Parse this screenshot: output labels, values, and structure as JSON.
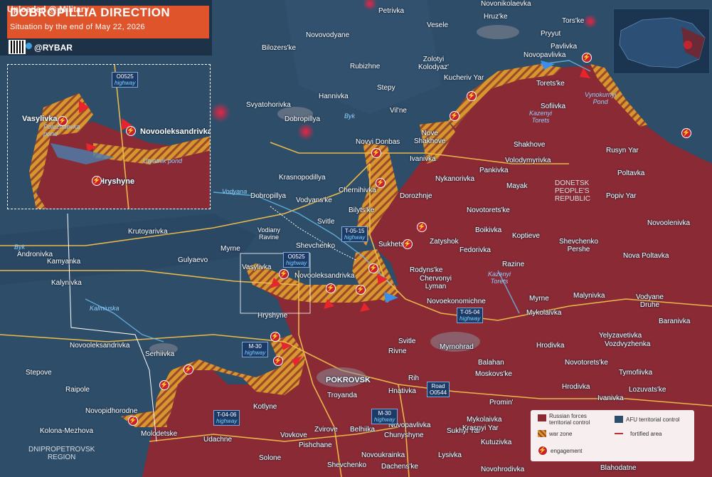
{
  "header": {
    "upload_text": "Uploaded @ Military",
    "title": "DOBROPILLIA DIRECTION",
    "subtitle": "Situation by the end of May 22, 2026",
    "brand": "@RYBAR"
  },
  "region_labels": {
    "donetsk": "DONETSK\nPEOPLE'S\nREPUBLIC",
    "dnipropetrovsk": "DNIPROPETROVSK\nREGION"
  },
  "settlements": [
    {
      "id": "petrivka",
      "name": "Petrivka"
    },
    {
      "id": "novonikolaevka",
      "name": "Novonikolaevka"
    },
    {
      "id": "torske",
      "name": "Tors'ke"
    },
    {
      "id": "novovodyane",
      "name": "Novovodyane"
    },
    {
      "id": "vesele",
      "name": "Vesele"
    },
    {
      "id": "hruzke",
      "name": "Hruz'ke"
    },
    {
      "id": "bilozerske",
      "name": "Bilozers'ke"
    },
    {
      "id": "pryyut",
      "name": "Pryyut"
    },
    {
      "id": "pavlivka",
      "name": "Pavlivka"
    },
    {
      "id": "novopavlivka_n",
      "name": "Novopavlivka"
    },
    {
      "id": "zolotyi",
      "name": "Zolotyi\nKolodyaz'"
    },
    {
      "id": "rubizhne",
      "name": "Rubizhne"
    },
    {
      "id": "kucheriv",
      "name": "Kucheriv Yar"
    },
    {
      "id": "torete",
      "name": "Torets'ke"
    },
    {
      "id": "stepy",
      "name": "Stepy"
    },
    {
      "id": "hannivka",
      "name": "Hannivka"
    },
    {
      "id": "svyatohorivka",
      "name": "Svyatohorivka"
    },
    {
      "id": "dobropillya",
      "name": "Dobropillya"
    },
    {
      "id": "vilne",
      "name": "Vil'ne"
    },
    {
      "id": "sofiivka",
      "name": "Sofiivka"
    },
    {
      "id": "nove_shakhove",
      "name": "Nove\nShakhove"
    },
    {
      "id": "novyi_donbas",
      "name": "Novyi Donbas"
    },
    {
      "id": "shakhove",
      "name": "Shakhove"
    },
    {
      "id": "rusyn_yar",
      "name": "Rusyn Yar"
    },
    {
      "id": "ivanivka",
      "name": "Ivanivka"
    },
    {
      "id": "volodymyrivka",
      "name": "Volodymyrivka"
    },
    {
      "id": "pankivka",
      "name": "Pankivka"
    },
    {
      "id": "poltavka",
      "name": "Poltavka"
    },
    {
      "id": "krasnopodillya",
      "name": "Krasnopodillya"
    },
    {
      "id": "nykanorivka",
      "name": "Nykanorivka"
    },
    {
      "id": "dorozhnje",
      "name": "Dorozhnje"
    },
    {
      "id": "mayak",
      "name": "Mayak"
    },
    {
      "id": "popiv_yar",
      "name": "Popiv Yar"
    },
    {
      "id": "dobropillya_w",
      "name": "Dobropillya"
    },
    {
      "id": "chernihivka",
      "name": "Chernihivka"
    },
    {
      "id": "vodyanske",
      "name": "Vodyans'ke"
    },
    {
      "id": "bilytske",
      "name": "Bilyts'ke"
    },
    {
      "id": "novotoretske",
      "name": "Novotorets'ke"
    },
    {
      "id": "krutoyarivka",
      "name": "Krutoyarivka"
    },
    {
      "id": "svitle",
      "name": "Svitle"
    },
    {
      "id": "boikivka",
      "name": "Boikivka"
    },
    {
      "id": "novoolenivka",
      "name": "Novoolenivka"
    },
    {
      "id": "zatyshok",
      "name": "Zatyshok"
    },
    {
      "id": "koptieve",
      "name": "Koptieve"
    },
    {
      "id": "andronivka",
      "name": "Andronivka"
    },
    {
      "id": "shevchenko",
      "name": "Shevchenko"
    },
    {
      "id": "sukhets",
      "name": "Sukhets'ke"
    },
    {
      "id": "fedorivka",
      "name": "Fedorivka"
    },
    {
      "id": "shevchenko_pershe",
      "name": "Shevchenko\nPershe"
    },
    {
      "id": "myrne",
      "name": "Myrne"
    },
    {
      "id": "nova_poltavka",
      "name": "Nova Poltavka"
    },
    {
      "id": "kamyanka",
      "name": "Kamyanka"
    },
    {
      "id": "gulyaevo",
      "name": "Gulyaevo"
    },
    {
      "id": "razine",
      "name": "Razine"
    },
    {
      "id": "vasylivka",
      "name": "Vasylivka"
    },
    {
      "id": "rodynske",
      "name": "Rodyns'ke"
    },
    {
      "id": "kalynivka",
      "name": "Kalynivka"
    },
    {
      "id": "novooleksandrivka",
      "name": "Novooleksandrivka"
    },
    {
      "id": "chervonyi",
      "name": "Chervonyi\nLyman"
    },
    {
      "id": "myrne_e",
      "name": "Myrne"
    },
    {
      "id": "malynivka",
      "name": "Malynivka"
    },
    {
      "id": "vodyane_druhe",
      "name": "Vodyane\nDruhe"
    },
    {
      "id": "novoekonomichne",
      "name": "Novoekonomichne"
    },
    {
      "id": "hryshyne",
      "name": "Hryshyne"
    },
    {
      "id": "mykolaivka",
      "name": "Mykolaivka"
    },
    {
      "id": "baranivka",
      "name": "Baranivka"
    },
    {
      "id": "svitle_s",
      "name": "Svitle"
    },
    {
      "id": "myrnohrad",
      "name": "Myrnohrad"
    },
    {
      "id": "yelyzavetivka",
      "name": "Yelyzavetivka"
    },
    {
      "id": "novooleksandrivka_w",
      "name": "Novooleksandrivka"
    },
    {
      "id": "vozdvyzhenka",
      "name": "Vozdvyzhenka"
    },
    {
      "id": "serhiivka",
      "name": "Serhiivka"
    },
    {
      "id": "rivne",
      "name": "Rivne"
    },
    {
      "id": "hrodivka_n",
      "name": "Hrodivka"
    },
    {
      "id": "balahan",
      "name": "Balahan"
    },
    {
      "id": "novotoretske_e",
      "name": "Novotorets'ke"
    },
    {
      "id": "stepove",
      "name": "Stepove"
    },
    {
      "id": "moskovske",
      "name": "Moskovs'ke"
    },
    {
      "id": "tymofiivka",
      "name": "Tymofiivka"
    },
    {
      "id": "pokrovsk",
      "name": "POKROVSK"
    },
    {
      "id": "rih",
      "name": "Rih"
    },
    {
      "id": "raipole",
      "name": "Raipole"
    },
    {
      "id": "hnativka",
      "name": "Hnativka"
    },
    {
      "id": "lozuvatske",
      "name": "Lozuvats'ke"
    },
    {
      "id": "troyanda",
      "name": "Troyanda"
    },
    {
      "id": "hrodivka",
      "name": "Hrodivka"
    },
    {
      "id": "ivanivka_s",
      "name": "Ivanivka"
    },
    {
      "id": "promin",
      "name": "Promin'"
    },
    {
      "id": "novopidhorodne",
      "name": "Novopidhorodne"
    },
    {
      "id": "kotlyne",
      "name": "Kotlyne"
    },
    {
      "id": "kolona",
      "name": "Kolona-Mezhova"
    },
    {
      "id": "novopavlivka",
      "name": "Novopavlivka"
    },
    {
      "id": "mykolaivka_s",
      "name": "Mykolaivka"
    },
    {
      "id": "molodetske",
      "name": "Molodetske"
    },
    {
      "id": "chunyshyne",
      "name": "Chunyshyne"
    },
    {
      "id": "sukhyi_yar",
      "name": "Sukhyi Yar"
    },
    {
      "id": "vovkove",
      "name": "Vovkove"
    },
    {
      "id": "zvirove",
      "name": "Zvirove"
    },
    {
      "id": "belhiika",
      "name": "Belhiika"
    },
    {
      "id": "krasnyi_yar",
      "name": "Krasnyi Yar"
    },
    {
      "id": "udachne",
      "name": "Udachne"
    },
    {
      "id": "pishchane",
      "name": "Pishchane"
    },
    {
      "id": "kutuzivka",
      "name": "Kutuzivka"
    },
    {
      "id": "novoukrainka",
      "name": "Novoukrainka"
    },
    {
      "id": "solone",
      "name": "Solone"
    },
    {
      "id": "lysivka",
      "name": "Lysivka"
    },
    {
      "id": "shevchenko_s",
      "name": "Shevchenko"
    },
    {
      "id": "dachenske",
      "name": "Dachens'ke"
    },
    {
      "id": "novohrodivka",
      "name": "Novohrodivka"
    },
    {
      "id": "blahodatne",
      "name": "Blahodatne"
    }
  ],
  "river_labels": [
    {
      "id": "byk",
      "name": "Byk"
    },
    {
      "id": "kazenyi_torets_n",
      "name": "Kazenyi\nTorets"
    },
    {
      "id": "vodyana",
      "name": "Vodyana"
    },
    {
      "id": "byk_w",
      "name": "Byk"
    },
    {
      "id": "kazenyi_torets_s",
      "name": "Kazenyi\nTorets"
    },
    {
      "id": "kalmiuska",
      "name": "Kalmiuska"
    },
    {
      "id": "vodiany_ravine",
      "name": "Vodiany\nRavine"
    },
    {
      "id": "vynokurnyi",
      "name": "Vynokurnyi\nPond"
    },
    {
      "id": "polezhaevka",
      "name": "Polezhaevka\npond"
    },
    {
      "id": "utyatnik",
      "name": "Utyatnik pond"
    }
  ],
  "road_tags": [
    {
      "id": "o0525_inset",
      "code": "O0525",
      "type": "highway"
    },
    {
      "id": "t0515",
      "code": "T-05-15",
      "type": "highway"
    },
    {
      "id": "o0525",
      "code": "O0525",
      "type": "highway"
    },
    {
      "id": "t0504",
      "code": "T-05-04",
      "type": "highway"
    },
    {
      "id": "m30_n",
      "code": "M-30",
      "type": "highway"
    },
    {
      "id": "road_o0544",
      "code": "Road",
      "type": "O0544"
    },
    {
      "id": "t0406",
      "code": "T-04-06",
      "type": "highway"
    },
    {
      "id": "m30_s",
      "code": "M-30",
      "type": "highway"
    }
  ],
  "inset": {
    "labels": [
      {
        "id": "in_vasylivka",
        "name": "Vasylivka"
      },
      {
        "id": "in_novooleksandrivka",
        "name": "Novooleksandrivka"
      },
      {
        "id": "in_hryshyne",
        "name": "Hryshyne"
      }
    ]
  },
  "legend": {
    "russian": "Russian forces\nterritorial control",
    "afu": "AFU territorial control",
    "war_zone": "war zone",
    "fortified": "fortified area",
    "engagement": "engagement"
  },
  "colors": {
    "russian_control": "#8a2a35",
    "afu_control": "#2e4d69",
    "war_zone_a": "#d8962e",
    "war_zone_b": "#9a4a2a",
    "engagement": "#c8202e",
    "title_bar": "#e0542c"
  }
}
